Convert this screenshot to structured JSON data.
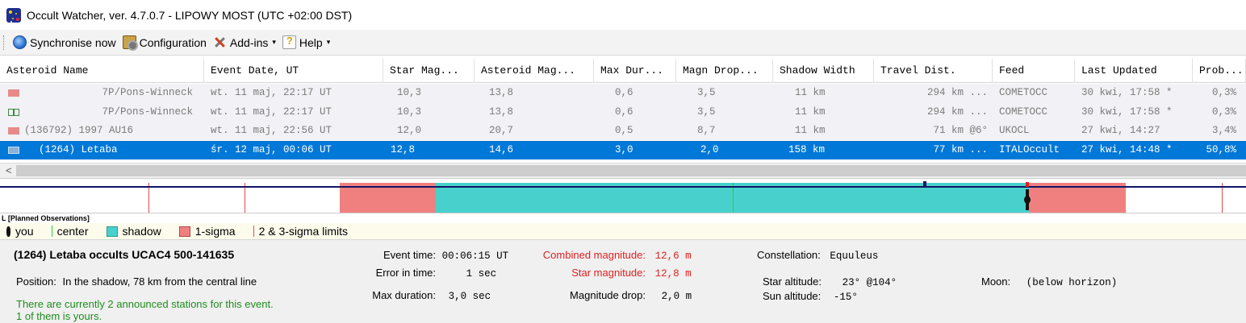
{
  "window": {
    "title": "Occult Watcher, ver. 4.7.0.7 - LIPOWY MOST (UTC +02:00 DST)"
  },
  "toolbar": {
    "sync_label": "Synchronise now",
    "config_label": "Configuration",
    "addins_label": "Add-ins",
    "help_label": "Help",
    "caret": "▾"
  },
  "grid": {
    "columns": [
      "Asteroid Name",
      "Event Date, UT",
      "Star Mag...",
      "Asteroid Mag...",
      "Max Dur...",
      "Magn Drop...",
      "Shadow Width",
      "Travel Dist.",
      "Feed",
      "Last Updated",
      "Prob..."
    ],
    "rows": [
      {
        "status": "plain",
        "name": "7P/Pons-Winneck",
        "date": "wt. 11 maj, 22:17 UT",
        "star_mag": "10,3",
        "ast_mag": "13,8",
        "max_dur": "0,6",
        "magn_drop": "3,5",
        "shadow_width": "11 km",
        "travel_dist": "294 km ...",
        "feed": "COMETOCC",
        "last_updated": "30 kwi, 17:58 *",
        "prob": "0,3%"
      },
      {
        "status": "user",
        "name": "7P/Pons-Winneck",
        "date": "wt. 11 maj, 22:17 UT",
        "star_mag": "10,3",
        "ast_mag": "13,8",
        "max_dur": "0,6",
        "magn_drop": "3,5",
        "shadow_width": "11 km",
        "travel_dist": "294 km ...",
        "feed": "COMETOCC",
        "last_updated": "30 kwi, 17:58 *",
        "prob": "0,3%"
      },
      {
        "status": "plain",
        "name": "(136792) 1997 AU16",
        "date": "wt. 11 maj, 22:56 UT",
        "star_mag": "12,0",
        "ast_mag": "20,7",
        "max_dur": "0,5",
        "magn_drop": "8,7",
        "shadow_width": "11 km",
        "travel_dist": "71 km @6°",
        "feed": "UKOCL",
        "last_updated": "27 kwi, 14:27",
        "prob": "3,4%"
      },
      {
        "status": "selected",
        "name": "(1264) Letaba",
        "date": "śr. 12 maj, 00:06 UT",
        "star_mag": "12,8",
        "ast_mag": "14,6",
        "max_dur": "3,0",
        "magn_drop": "2,0",
        "shadow_width": "158 km",
        "travel_dist": "77 km ...",
        "feed": "ITALOccult",
        "last_updated": "27 kwi, 14:48 *",
        "prob": "50,8%"
      }
    ],
    "scroll_left_arrow": "<"
  },
  "timeline": {
    "planned_label": "L [Planned Observations]"
  },
  "legend": {
    "you": "you",
    "center": "center",
    "shadow": "shadow",
    "sigma1": "1-sigma",
    "limits": "2 & 3-sigma limits"
  },
  "details": {
    "title": "(1264) Letaba occults UCAC4 500-141635",
    "position_label": "Position:",
    "position_value": "In the shadow, 78 km from the central line",
    "stations_line1": "There are currently 2 announced stations for this event.",
    "stations_line2": "1 of them is yours.",
    "event_time_label": "Event time:",
    "event_time_value": "00:06:15 UT",
    "error_label": "Error in time:",
    "error_value": "1 sec",
    "max_duration_label": "Max duration:",
    "max_duration_value": "3,0 sec",
    "combined_mag_label": "Combined magnitude:",
    "combined_mag_value": "12,6 m",
    "star_mag_label": "Star magnitude:",
    "star_mag_value": "12,8 m",
    "magn_drop_label": "Magnitude drop:",
    "magn_drop_value": "2,0 m",
    "constellation_label": "Constellation:",
    "constellation_value": "Equuleus",
    "star_alt_label": "Star altitude:",
    "star_alt_value": "23° @104°",
    "sun_alt_label": "Sun altitude:",
    "sun_alt_value": "-15°",
    "moon_label": "Moon:",
    "moon_value": "(below horizon)"
  },
  "colors": {
    "selection": "#0078d7",
    "shadow": "#48d1cc",
    "sigma": "#f08080",
    "limit": "#e84a4a",
    "center": "#33cc33",
    "axis": "#111466",
    "alert_text": "#e02020",
    "info_text": "#1e8c1e"
  }
}
